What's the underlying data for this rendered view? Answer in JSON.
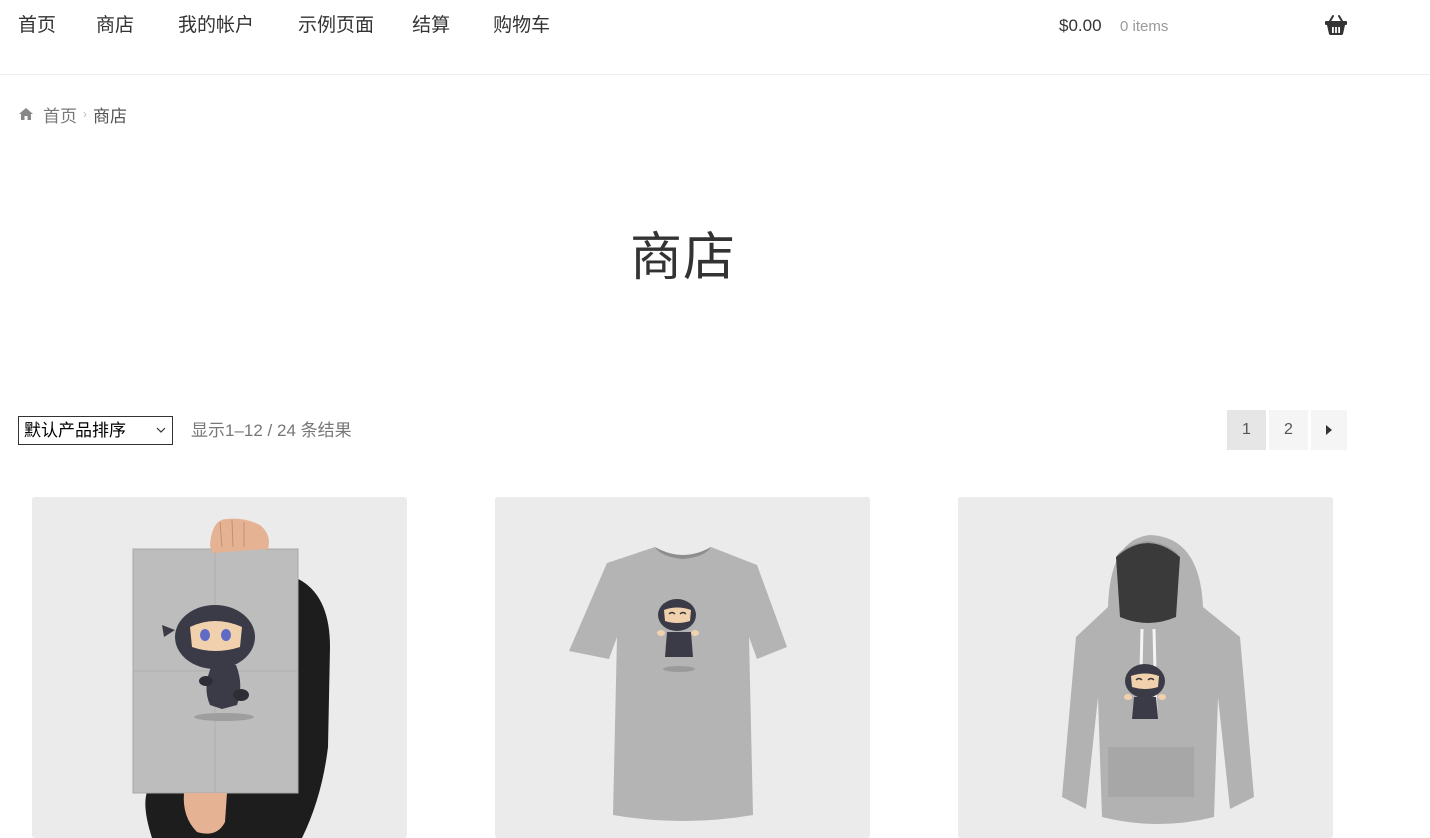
{
  "nav": {
    "items": [
      {
        "label": "首页"
      },
      {
        "label": "商店"
      },
      {
        "label": "我的帐户"
      },
      {
        "label": "示例页面"
      },
      {
        "label": "结算"
      },
      {
        "label": "购物车"
      }
    ]
  },
  "cart": {
    "total": "$0.00",
    "count": "0 items",
    "icon": "basket-icon"
  },
  "breadcrumb": {
    "icon": "home-icon",
    "home": "首页",
    "separator": "›",
    "current": "商店"
  },
  "page": {
    "title": "商店"
  },
  "toolbar": {
    "sort_selected": "默认产品排序",
    "result_count": "显示1–12 / 24 条结果",
    "pages": [
      "1",
      "2"
    ],
    "current_page": "1",
    "next_icon": "caret-right-icon"
  },
  "products": [
    {
      "image": "ninja-poster-image"
    },
    {
      "image": "ninja-tshirt-image"
    },
    {
      "image": "ninja-hoodie-image"
    }
  ]
}
